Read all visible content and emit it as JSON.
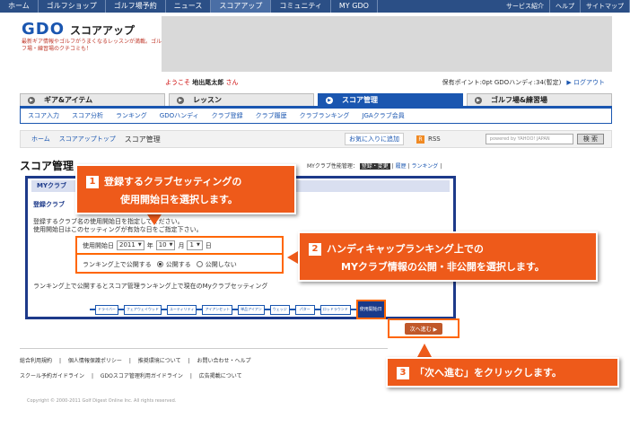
{
  "topnav": {
    "items": [
      "ホーム",
      "ゴルフショップ",
      "ゴルフ場予約",
      "ニュース",
      "スコアアップ",
      "コミュニティ",
      "MY GDO"
    ],
    "right": [
      "サービス紹介",
      "ヘルプ",
      "サイトマップ"
    ]
  },
  "logo": {
    "mark": "GDO",
    "sub": "スコアアップ"
  },
  "tagline": "最新ギア情報やゴルフがうまくなるレッスンが満載。ゴルフ場・練習場のクチコミも！",
  "welcome": {
    "prefix": "ようこそ",
    "name": "地出尾太郎",
    "suffix": "さん"
  },
  "userinfo": {
    "text": "保有ポイント:0pt GDOハンディ:34(暫定)",
    "logout": "▶ ログアウト"
  },
  "cattabs": [
    {
      "label": "ギア&アイテム"
    },
    {
      "label": "レッスン"
    },
    {
      "label": "スコア管理"
    },
    {
      "label": "ゴルフ場&練習場"
    }
  ],
  "subnav": [
    "スコア入力",
    "スコア分析",
    "ランキング",
    "GDOハンディ",
    "クラブ登録",
    "クラブ履歴",
    "クラブランキング",
    "JGAクラブ会員"
  ],
  "breadcrumb": {
    "home": "ホーム",
    "mid": "スコアアップトップ",
    "current": "スコア管理"
  },
  "toolbar": {
    "fav": "お気に入りに追加",
    "rss": "RSS",
    "rss_icon": "R",
    "search_placeholder": "powered by YAHOO! JAPAN",
    "search_btn": "検 索"
  },
  "page_title": "スコア管理",
  "mgmt": {
    "label": "MYクラブ性能管理：",
    "selected": "登録・変更",
    "history": "履歴",
    "ranking": "ランキング"
  },
  "panel": {
    "title": "MYクラブ",
    "section": "登録クラブ",
    "desc1": "登録するクラブ名の使用開始日を指定してください。",
    "desc2": "使用開始日はこのセッティングが有効な日をご指定下さい。",
    "footnote": "ランキング上で公開するとスコア管理ランキング上で現在のMyクラブセッティング"
  },
  "form": {
    "start_label": "使用開始日",
    "year": "2011",
    "year_unit": "年",
    "month": "10",
    "month_unit": "月",
    "day": "1",
    "day_unit": "日",
    "publish_label": "ランキング上で公開する",
    "opt_public": "公開する",
    "opt_private": "公開しない"
  },
  "steps": [
    "ドライバー",
    "フェアウェイウッド",
    "ユーティリティ",
    "アイアンセット",
    "単品アイアン",
    "ウェッジ",
    "パター",
    "ロッドラウンド",
    "使用開始日"
  ],
  "next_button": "次へ進む ▶",
  "callouts": {
    "c1_num": "1",
    "c1_line1": "登録するクラブセッティングの",
    "c1_line2": "使用開始日を選択します。",
    "c2_num": "2",
    "c2_line1": "ハンディキャップランキング上での",
    "c2_line2": "MYクラブ情報の公開・非公開を選択します。",
    "c3_num": "3",
    "c3_text": "「次へ進む」をクリックします。"
  },
  "footer": {
    "row1": [
      "総合利用規約",
      "|",
      "個人情報保護ポリシー",
      "|",
      "推奨環境について",
      "|",
      "お問い合わせ・ヘルプ"
    ],
    "row2": [
      "スクール予約ガイドライン",
      "|",
      "GDOスコア管理利用ガイドライン",
      "|",
      "広告掲載について"
    ],
    "copyright": "Copyright © 2000-2011 Golf Digest Online Inc. All rights reserved."
  }
}
